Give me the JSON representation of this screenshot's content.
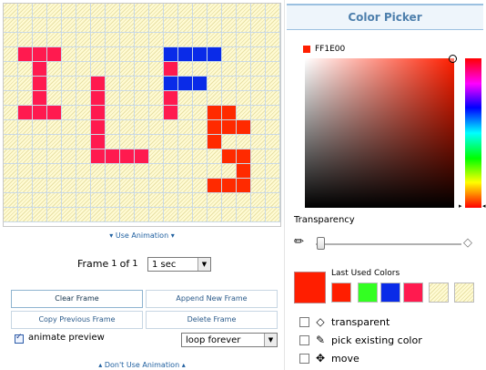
{
  "grid": {
    "cols": 19,
    "rows": 15,
    "cells": [
      {
        "r": 3,
        "c": 1,
        "color": "#ff1a4f"
      },
      {
        "r": 3,
        "c": 2,
        "color": "#ff1a4f"
      },
      {
        "r": 3,
        "c": 3,
        "color": "#ff1a4f"
      },
      {
        "r": 4,
        "c": 2,
        "color": "#ff1a4f"
      },
      {
        "r": 5,
        "c": 2,
        "color": "#ff1a4f"
      },
      {
        "r": 6,
        "c": 2,
        "color": "#ff1a4f"
      },
      {
        "r": 7,
        "c": 1,
        "color": "#ff1a4f"
      },
      {
        "r": 7,
        "c": 2,
        "color": "#ff1a4f"
      },
      {
        "r": 7,
        "c": 3,
        "color": "#ff1a4f"
      },
      {
        "r": 5,
        "c": 6,
        "color": "#ff1a4f"
      },
      {
        "r": 6,
        "c": 6,
        "color": "#ff1a4f"
      },
      {
        "r": 7,
        "c": 6,
        "color": "#ff1a4f"
      },
      {
        "r": 8,
        "c": 6,
        "color": "#ff1a4f"
      },
      {
        "r": 9,
        "c": 6,
        "color": "#ff1a4f"
      },
      {
        "r": 10,
        "c": 6,
        "color": "#ff1a4f"
      },
      {
        "r": 10,
        "c": 7,
        "color": "#ff1a4f"
      },
      {
        "r": 10,
        "c": 8,
        "color": "#ff1a4f"
      },
      {
        "r": 10,
        "c": 9,
        "color": "#ff1a4f"
      },
      {
        "r": 3,
        "c": 11,
        "color": "#0a2be8"
      },
      {
        "r": 3,
        "c": 12,
        "color": "#0a2be8"
      },
      {
        "r": 3,
        "c": 13,
        "color": "#0a2be8"
      },
      {
        "r": 3,
        "c": 14,
        "color": "#0a2be8"
      },
      {
        "r": 4,
        "c": 11,
        "color": "#ff1a4f"
      },
      {
        "r": 5,
        "c": 11,
        "color": "#0a2be8"
      },
      {
        "r": 5,
        "c": 12,
        "color": "#0a2be8"
      },
      {
        "r": 5,
        "c": 13,
        "color": "#0a2be8"
      },
      {
        "r": 6,
        "c": 11,
        "color": "#ff1a4f"
      },
      {
        "r": 7,
        "c": 11,
        "color": "#ff1a4f"
      },
      {
        "r": 7,
        "c": 14,
        "color": "#ff2a00"
      },
      {
        "r": 7,
        "c": 15,
        "color": "#ff2a00"
      },
      {
        "r": 8,
        "c": 14,
        "color": "#ff2a00"
      },
      {
        "r": 8,
        "c": 15,
        "color": "#ff2a00"
      },
      {
        "r": 8,
        "c": 16,
        "color": "#ff2a00"
      },
      {
        "r": 9,
        "c": 14,
        "color": "#ff2a00"
      },
      {
        "r": 10,
        "c": 15,
        "color": "#ff2a00"
      },
      {
        "r": 10,
        "c": 16,
        "color": "#ff2a00"
      },
      {
        "r": 11,
        "c": 16,
        "color": "#ff2a00"
      },
      {
        "r": 12,
        "c": 14,
        "color": "#ff2a00"
      },
      {
        "r": 12,
        "c": 15,
        "color": "#ff2a00"
      },
      {
        "r": 12,
        "c": 16,
        "color": "#ff2a00"
      }
    ]
  },
  "links": {
    "use_animation": "Use Animation",
    "dont_use_animation": "Don't Use Animation"
  },
  "frame": {
    "label": "Frame",
    "current": "1",
    "of_label": "of",
    "total": "1",
    "duration": "1 sec"
  },
  "buttons": {
    "clear_frame": "Clear Frame",
    "append_new_frame": "Append New Frame",
    "copy_previous_frame": "Copy Previous Frame",
    "delete_frame": "Delete Frame"
  },
  "animate_preview": {
    "label": "animate preview",
    "checked": true,
    "loop_option": "loop forever"
  },
  "color_picker": {
    "title": "Color Picker",
    "hex": "FF1E00",
    "current_color": "#ff1e00",
    "transparency_label": "Transparency",
    "transparency_value": 0,
    "last_used_label": "Last Used Colors",
    "last_used_colors": [
      "#ff1e00",
      "#33ff22",
      "#0a2be8",
      "#ff1a4f",
      "transparent",
      "transparent"
    ],
    "options": [
      {
        "label": "transparent",
        "icon": "eraser-icon",
        "glyph": "◇"
      },
      {
        "label": "pick existing color",
        "icon": "eyedropper-icon",
        "glyph": "✎"
      },
      {
        "label": "move",
        "icon": "move-icon",
        "glyph": "✥"
      }
    ]
  },
  "icons": {
    "pencil": "✏",
    "eraser": "◇",
    "dropdown": "▼",
    "chevron_down": "▾",
    "chevron_up": "▴"
  }
}
